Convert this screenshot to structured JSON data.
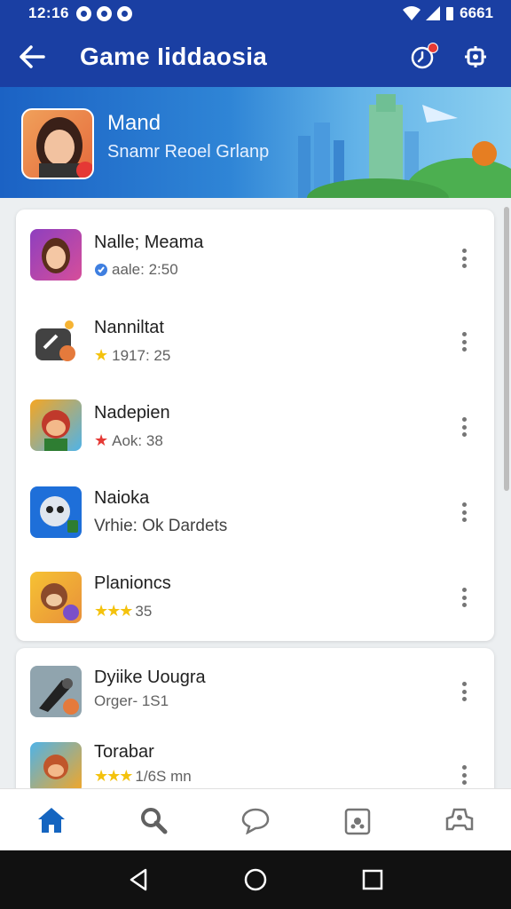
{
  "status_bar": {
    "time": "12:16",
    "right_text": "6661"
  },
  "app_bar": {
    "title": "Game Iiddaosia",
    "back_icon": "arrow-left-icon",
    "notif_icon": "clock-icon",
    "settings_icon": "gear-icon"
  },
  "banner": {
    "name": "Mand",
    "subtitle": "Snamr Reoel Grlanp"
  },
  "list_1": [
    {
      "title": "Nalle; Meama",
      "sub": "aale: 2:50",
      "badge": "shield"
    },
    {
      "title": "Nanniltat",
      "sub": "1917: 25",
      "badge": "star-gold"
    },
    {
      "title": "Nadepien",
      "sub": "Aok: 38",
      "badge": "star-red"
    },
    {
      "title": "Naioka",
      "sub": "Vrhie: Ok Dardets",
      "badge": "none"
    },
    {
      "title": "Planioncs",
      "sub": "35",
      "badge": "three-stars"
    }
  ],
  "list_2": [
    {
      "title": "Dyiike Uougra",
      "sub": "Orger- 1S1",
      "badge": "none"
    },
    {
      "title": "Torabar",
      "sub": "1/6S mn",
      "badge": "three-stars"
    }
  ],
  "bottom_nav": [
    "home-icon",
    "search-icon",
    "chat-icon",
    "puzzle-icon",
    "controller-icon"
  ],
  "colors": {
    "primary": "#1a3fa3",
    "accent": "#1565c0"
  }
}
